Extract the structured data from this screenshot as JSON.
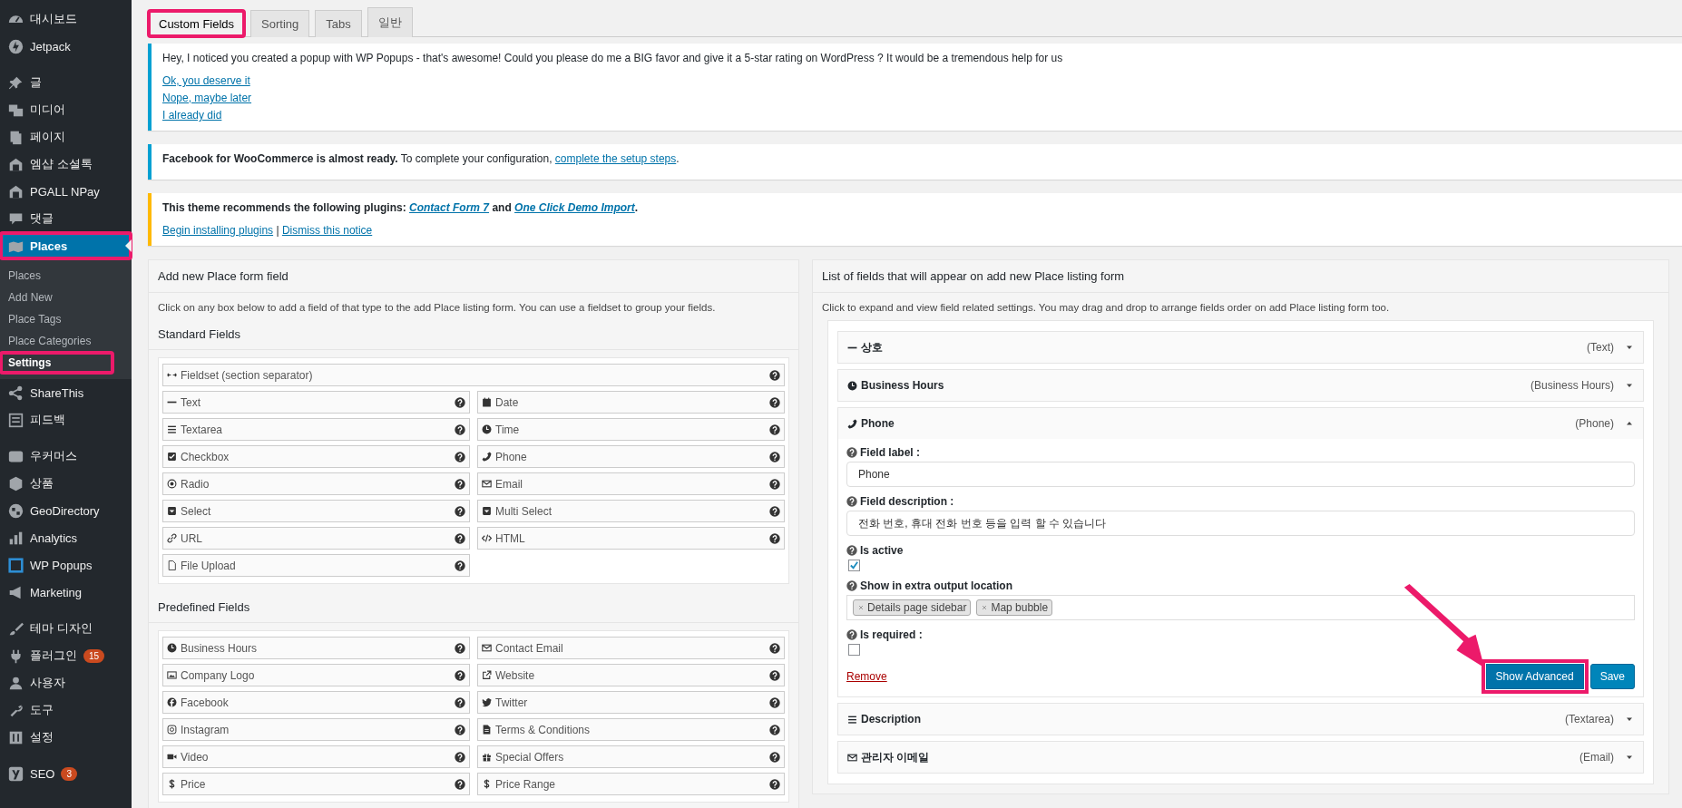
{
  "sidebar": {
    "groups": [
      {
        "items": [
          {
            "label": "대시보드",
            "selected": false,
            "highlighted": false
          },
          {
            "label": "Jetpack",
            "selected": false,
            "highlighted": false
          }
        ]
      },
      {
        "items": [
          {
            "label": "글",
            "selected": false,
            "highlighted": false
          },
          {
            "label": "미디어",
            "selected": false,
            "highlighted": false
          },
          {
            "label": "페이지",
            "selected": false,
            "highlighted": false
          },
          {
            "label": "엠샵 소셜톡",
            "selected": false,
            "highlighted": false
          },
          {
            "label": "PGALL NPay",
            "selected": false,
            "highlighted": false
          },
          {
            "label": "댓글",
            "selected": false,
            "highlighted": false
          },
          {
            "label": "Places",
            "selected": true,
            "highlighted": true,
            "children": [
              {
                "label": "Places",
                "selected": false,
                "highlighted": false
              },
              {
                "label": "Add New",
                "selected": false,
                "highlighted": false
              },
              {
                "label": "Place Tags",
                "selected": false,
                "highlighted": false
              },
              {
                "label": "Place Categories",
                "selected": false,
                "highlighted": false
              },
              {
                "label": "Settings",
                "selected": true,
                "highlighted": true
              }
            ]
          },
          {
            "label": "ShareThis",
            "selected": false,
            "highlighted": false
          },
          {
            "label": "피드백",
            "selected": false,
            "highlighted": false
          }
        ]
      },
      {
        "items": [
          {
            "label": "우커머스",
            "selected": false,
            "highlighted": false
          },
          {
            "label": "상품",
            "selected": false,
            "highlighted": false
          },
          {
            "label": "GeoDirectory",
            "selected": false,
            "highlighted": false
          },
          {
            "label": "Analytics",
            "selected": false,
            "highlighted": false
          },
          {
            "label": "WP Popups",
            "selected": false,
            "highlighted": false
          },
          {
            "label": "Marketing",
            "selected": false,
            "highlighted": false
          }
        ]
      },
      {
        "items": [
          {
            "label": "테마 디자인",
            "selected": false,
            "highlighted": false
          },
          {
            "label": "플러그인",
            "selected": false,
            "highlighted": false,
            "badge": "15"
          },
          {
            "label": "사용자",
            "selected": false,
            "highlighted": false
          },
          {
            "label": "도구",
            "selected": false,
            "highlighted": false
          },
          {
            "label": "설정",
            "selected": false,
            "highlighted": false
          }
        ]
      },
      {
        "items": [
          {
            "label": "SEO",
            "selected": false,
            "highlighted": false,
            "badge": "3"
          }
        ]
      }
    ]
  },
  "tabs": [
    {
      "label": "Custom Fields",
      "selected": true,
      "highlighted": true
    },
    {
      "label": "Sorting",
      "selected": false,
      "highlighted": false
    },
    {
      "label": "Tabs",
      "selected": false,
      "highlighted": false
    },
    {
      "label": "일반",
      "selected": false,
      "highlighted": false
    }
  ],
  "notices": [
    {
      "color": "#00a0d2",
      "paragraphs": [
        {
          "segments": [
            {
              "kind": "text",
              "text": "Hey, I noticed you created a popup with WP Popups - that's awesome! Could you please do me a BIG favor and give it a 5-star rating on WordPress ? It would be a tremendous help for us"
            }
          ]
        },
        {
          "segments": [
            {
              "kind": "link",
              "text": "Ok, you deserve it"
            }
          ]
        },
        {
          "segments": [
            {
              "kind": "link",
              "text": "Nope, maybe later"
            }
          ]
        },
        {
          "segments": [
            {
              "kind": "link",
              "text": "I already did"
            }
          ]
        }
      ]
    },
    {
      "color": "#00a0d2",
      "paragraphs": [
        {
          "segments": [
            {
              "kind": "text",
              "text": "**Facebook for WooCommerce is almost ready.** To complete your configuration, "
            },
            {
              "kind": "link",
              "text": "complete the setup steps"
            },
            {
              "kind": "text",
              "text": "."
            }
          ]
        }
      ]
    },
    {
      "color": "#ffb900",
      "paragraphs": [
        {
          "segments": [
            {
              "kind": "text",
              "text": "**This theme recommends the following plugins:** "
            },
            {
              "kind": "emphasized_link",
              "text": "Contact Form 7"
            },
            {
              "kind": "text",
              "text": " **and** "
            },
            {
              "kind": "emphasized_link",
              "text": "One Click Demo Import"
            },
            {
              "kind": "text",
              "text": "**.**"
            }
          ]
        },
        {
          "segments": [
            {
              "kind": "link",
              "text": "Begin installing plugins"
            },
            {
              "kind": "text",
              "text": " | "
            },
            {
              "kind": "link",
              "text": "Dismiss this notice"
            }
          ]
        }
      ]
    }
  ],
  "left_panel": {
    "title": "Add new Place form field",
    "description": "Click on any box below to add a field of that type to the add Place listing form. You can use a fieldset to group your fields.",
    "sections": [
      {
        "title": "Standard Fields",
        "fields": [
          {
            "label": "Fieldset (section separator)",
            "kind": "wide"
          },
          {
            "label": "Text",
            "kind": "half"
          },
          {
            "label": "Date",
            "kind": "half"
          },
          {
            "label": "Textarea",
            "kind": "half"
          },
          {
            "label": "Time",
            "kind": "half"
          },
          {
            "label": "Checkbox",
            "kind": "half"
          },
          {
            "label": "Phone",
            "kind": "half"
          },
          {
            "label": "Radio",
            "kind": "half"
          },
          {
            "label": "Email",
            "kind": "half"
          },
          {
            "label": "Select",
            "kind": "half"
          },
          {
            "label": "Multi Select",
            "kind": "half"
          },
          {
            "label": "URL",
            "kind": "half"
          },
          {
            "label": "HTML",
            "kind": "half"
          },
          {
            "label": "File Upload",
            "kind": "half"
          }
        ]
      },
      {
        "title": "Predefined Fields",
        "fields": [
          {
            "label": "Business Hours",
            "kind": "half"
          },
          {
            "label": "Contact Email",
            "kind": "half"
          },
          {
            "label": "Company Logo",
            "kind": "half"
          },
          {
            "label": "Website",
            "kind": "half"
          },
          {
            "label": "Facebook",
            "kind": "half"
          },
          {
            "label": "Twitter",
            "kind": "half"
          },
          {
            "label": "Instagram",
            "kind": "half"
          },
          {
            "label": "Terms & Conditions",
            "kind": "half"
          },
          {
            "label": "Video",
            "kind": "half"
          },
          {
            "label": "Special Offers",
            "kind": "half"
          },
          {
            "label": "Price",
            "kind": "half"
          },
          {
            "label": "Price Range",
            "kind": "half"
          }
        ]
      }
    ]
  },
  "right_panel": {
    "title": "List of fields that will appear on add new Place listing form",
    "description": "Click to expand and view field related settings. You may drag and drop to arrange fields order on add Place listing form too.",
    "fields": [
      {
        "label": "상호",
        "type": "(Text)",
        "expanded": false
      },
      {
        "label": "Business Hours",
        "type": "(Business Hours)",
        "expanded": false
      },
      {
        "label": "Phone",
        "type": "(Phone)",
        "expanded": true,
        "settings": [
          {
            "kind": "input",
            "label": "Field label :",
            "value": "Phone"
          },
          {
            "kind": "input",
            "label": "Field description :",
            "value": "전화 번호, 휴대 전화 번호 등을 입력 할 수 있습니다"
          },
          {
            "kind": "checkbox",
            "label": "Is active",
            "checked": true
          },
          {
            "kind": "tags",
            "label": "Show in extra output location",
            "tags": [
              "Details page sidebar",
              "Map bubble"
            ]
          },
          {
            "kind": "checkbox",
            "label": "Is required :",
            "checked": false
          }
        ],
        "remove": "Remove",
        "buttons": [
          {
            "label": "Show Advanced",
            "kind": "secondary",
            "highlighted": true
          },
          {
            "label": "Save",
            "kind": "primary",
            "highlighted": false
          }
        ]
      },
      {
        "label": "Description",
        "type": "(Textarea)",
        "expanded": false
      },
      {
        "label": "관리자 이메일",
        "type": "(Email)",
        "expanded": false
      }
    ]
  }
}
